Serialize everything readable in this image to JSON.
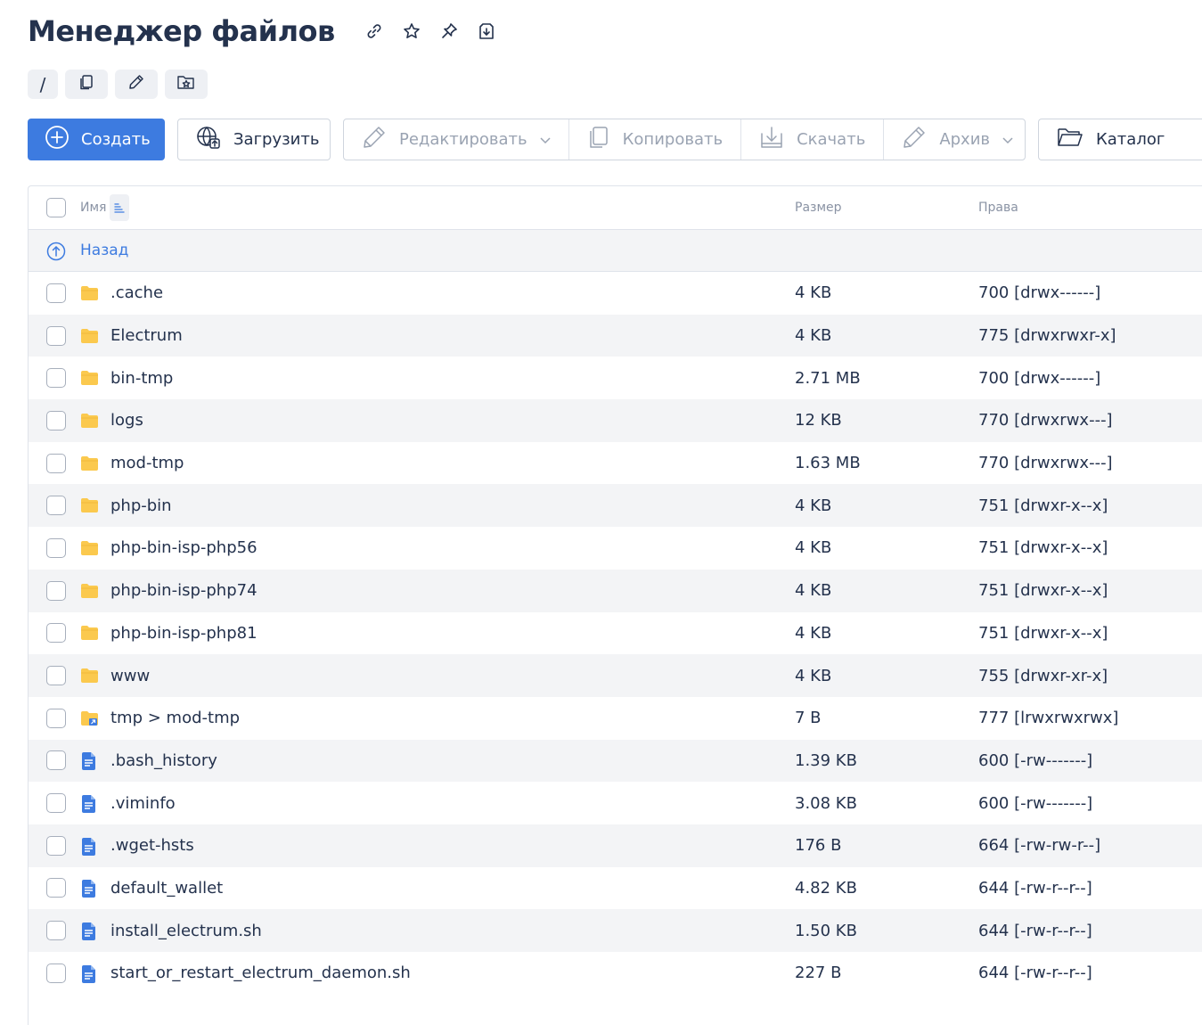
{
  "page": {
    "title": "Менеджер файлов",
    "title_icons": [
      "link-icon",
      "star-icon",
      "pin-icon",
      "download-file-icon"
    ]
  },
  "breadcrumb": {
    "root": "/",
    "icons": [
      "copy-icon",
      "edit-icon",
      "favorites-icon"
    ]
  },
  "toolbar": {
    "create_label": "Создать",
    "upload_label": "Загрузить",
    "edit_label": "Редактировать",
    "copy_label": "Копировать",
    "download_label": "Скачать",
    "archive_label": "Архив",
    "catalog_label": "Каталог"
  },
  "table": {
    "headers": {
      "name": "Имя",
      "size": "Размер",
      "perms": "Права"
    },
    "back_label": "Назад",
    "rows": [
      {
        "name": ".cache",
        "size": "4 KB",
        "perms": "700 [drwx------]",
        "type": "folder"
      },
      {
        "name": "Electrum",
        "size": "4 KB",
        "perms": "775 [drwxrwxr-x]",
        "type": "folder"
      },
      {
        "name": "bin-tmp",
        "size": "2.71 MB",
        "perms": "700 [drwx------]",
        "type": "folder"
      },
      {
        "name": "logs",
        "size": "12 KB",
        "perms": "770 [drwxrwx---]",
        "type": "folder"
      },
      {
        "name": "mod-tmp",
        "size": "1.63 MB",
        "perms": "770 [drwxrwx---]",
        "type": "folder"
      },
      {
        "name": "php-bin",
        "size": "4 KB",
        "perms": "751 [drwxr-x--x]",
        "type": "folder"
      },
      {
        "name": "php-bin-isp-php56",
        "size": "4 KB",
        "perms": "751 [drwxr-x--x]",
        "type": "folder"
      },
      {
        "name": "php-bin-isp-php74",
        "size": "4 KB",
        "perms": "751 [drwxr-x--x]",
        "type": "folder"
      },
      {
        "name": "php-bin-isp-php81",
        "size": "4 KB",
        "perms": "751 [drwxr-x--x]",
        "type": "folder"
      },
      {
        "name": "www",
        "size": "4 KB",
        "perms": "755 [drwxr-xr-x]",
        "type": "folder"
      },
      {
        "name": "tmp > mod-tmp",
        "size": "7 B",
        "perms": "777 [lrwxrwxrwx]",
        "type": "symlink"
      },
      {
        "name": ".bash_history",
        "size": "1.39 KB",
        "perms": "600 [-rw-------]",
        "type": "file"
      },
      {
        "name": ".viminfo",
        "size": "3.08 KB",
        "perms": "600 [-rw-------]",
        "type": "file"
      },
      {
        "name": ".wget-hsts",
        "size": "176 B",
        "perms": "664 [-rw-rw-r--]",
        "type": "file"
      },
      {
        "name": "default_wallet",
        "size": "4.82 KB",
        "perms": "644 [-rw-r--r--]",
        "type": "file"
      },
      {
        "name": "install_electrum.sh",
        "size": "1.50 KB",
        "perms": "644 [-rw-r--r--]",
        "type": "file"
      },
      {
        "name": "start_or_restart_electrum_daemon.sh",
        "size": "227 B",
        "perms": "644 [-rw-r--r--]",
        "type": "file"
      }
    ]
  },
  "colors": {
    "primary": "#3d7be0",
    "folder": "#f9c74f",
    "file": "#3d7be0",
    "title": "#24324d",
    "muted": "#9aa3b2"
  }
}
